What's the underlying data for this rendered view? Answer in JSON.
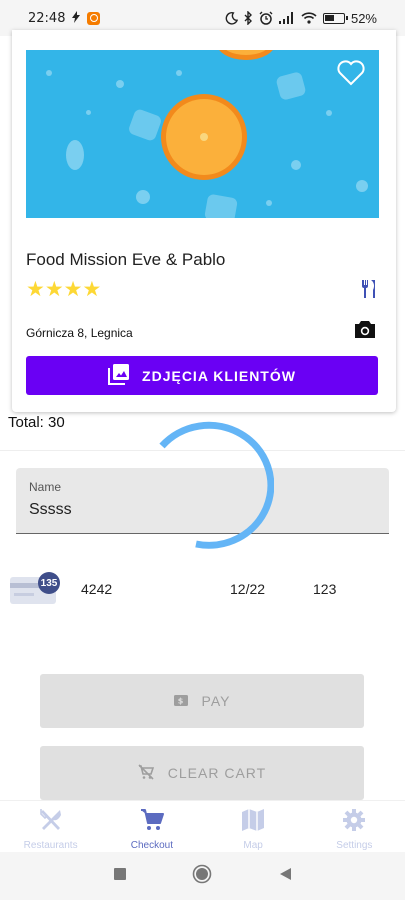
{
  "status_bar": {
    "time": "22:48",
    "battery": "52%",
    "icons": [
      "moon-icon",
      "bluetooth-icon",
      "alarm-icon",
      "signal-icon",
      "wifi-icon",
      "battery-icon"
    ]
  },
  "restaurant": {
    "name": "Food Mission Eve & Pablo",
    "rating": 4,
    "stars": "★★★★",
    "address": "Górnicza 8, Legnica",
    "photos_button": "ZDJĘCIA KLIENTÓW"
  },
  "checkout": {
    "total": "Total: 30",
    "name_label": "Name",
    "name_value": "Sssss",
    "card": {
      "count_badge": "135",
      "number": "4242",
      "expiry": "12/22",
      "cvc": "123"
    },
    "pay_label": "PAY",
    "clear_cart_label": "CLEAR CART"
  },
  "bottom_nav": {
    "items": [
      {
        "label": "Restaurants",
        "icon": "cutlery-icon",
        "active": false
      },
      {
        "label": "Checkout",
        "icon": "cart-icon",
        "active": true
      },
      {
        "label": "Map",
        "icon": "map-icon",
        "active": false
      },
      {
        "label": "Settings",
        "icon": "gear-icon",
        "active": false
      }
    ]
  },
  "colors": {
    "accent": "#6a00f4",
    "active_nav": "#5c6bc0",
    "inactive_nav": "#c5cde8",
    "spinner": "#64b5f6",
    "disabled_button": "#e0e0e0"
  }
}
